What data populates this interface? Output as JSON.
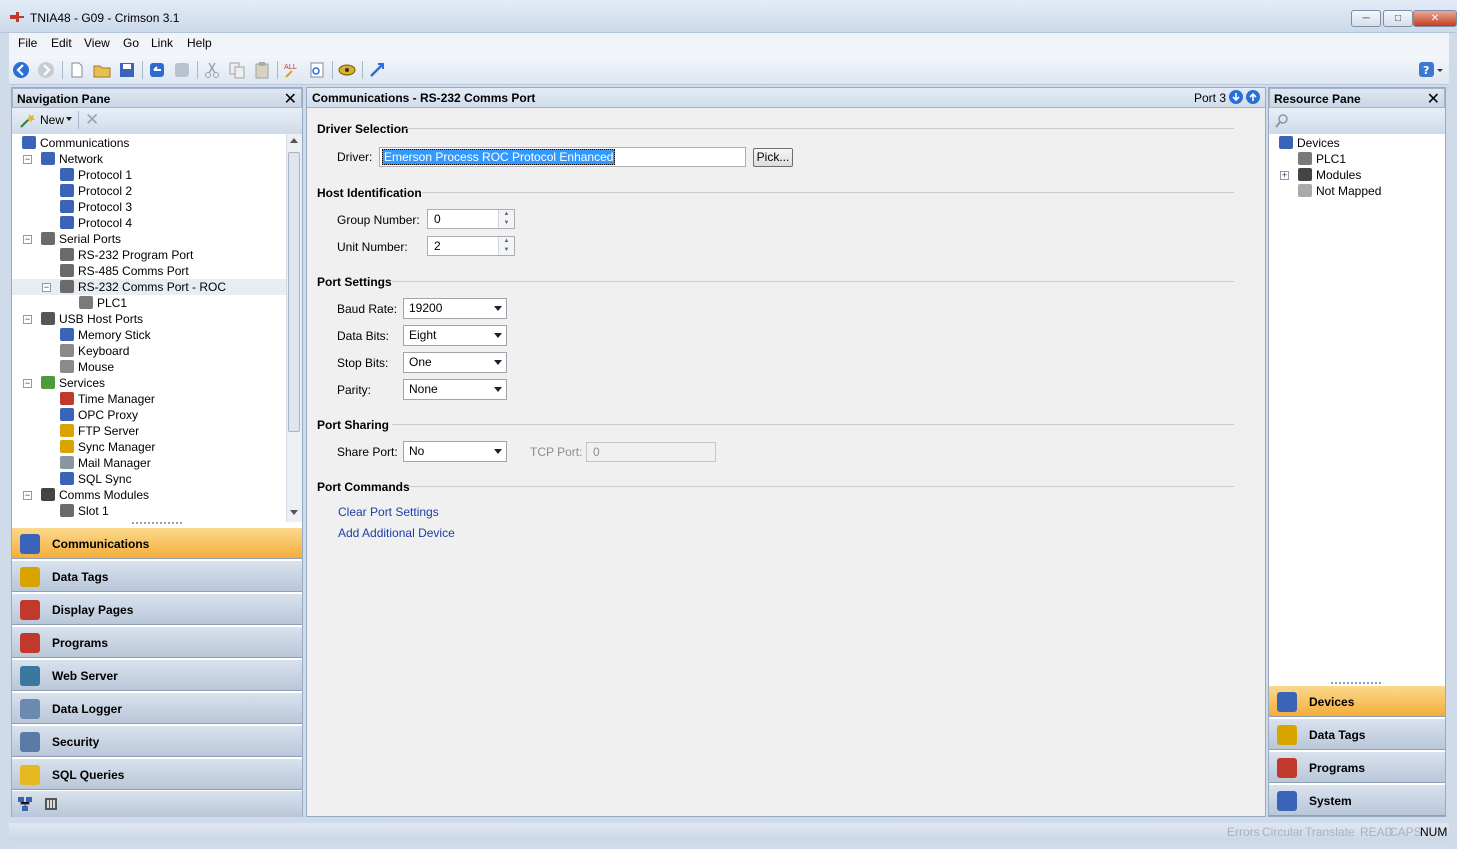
{
  "window": {
    "title": "TNIA48 - G09 - Crimson 3.1"
  },
  "menu": [
    "File",
    "Edit",
    "View",
    "Go",
    "Link",
    "Help"
  ],
  "navigation_pane": {
    "title": "Navigation Pane",
    "new_label": "New",
    "tree": [
      {
        "label": "Communications",
        "level": 0,
        "icon": "communications-icon"
      },
      {
        "label": "Network",
        "level": 1,
        "icon": "network-icon",
        "expander": "minus"
      },
      {
        "label": "Protocol 1",
        "level": 2,
        "icon": "protocol-icon"
      },
      {
        "label": "Protocol 2",
        "level": 2,
        "icon": "protocol-icon"
      },
      {
        "label": "Protocol 3",
        "level": 2,
        "icon": "protocol-icon"
      },
      {
        "label": "Protocol 4",
        "level": 2,
        "icon": "protocol-icon"
      },
      {
        "label": "Serial Ports",
        "level": 1,
        "icon": "serial-port-icon",
        "expander": "minus"
      },
      {
        "label": "RS-232 Program Port",
        "level": 2,
        "icon": "serial-port-icon"
      },
      {
        "label": "RS-485 Comms Port",
        "level": 2,
        "icon": "serial-port-icon"
      },
      {
        "label": "RS-232 Comms Port - ROC",
        "level": 2,
        "icon": "serial-port-icon",
        "expander": "minus",
        "selected": true
      },
      {
        "label": "PLC1",
        "level": 3,
        "icon": "plc-icon"
      },
      {
        "label": "USB Host Ports",
        "level": 1,
        "icon": "usb-icon",
        "expander": "minus"
      },
      {
        "label": "Memory Stick",
        "level": 2,
        "icon": "memory-stick-icon"
      },
      {
        "label": "Keyboard",
        "level": 2,
        "icon": "keyboard-icon"
      },
      {
        "label": "Mouse",
        "level": 2,
        "icon": "mouse-icon"
      },
      {
        "label": "Services",
        "level": 1,
        "icon": "services-icon",
        "expander": "minus"
      },
      {
        "label": "Time Manager",
        "level": 2,
        "icon": "time-manager-icon"
      },
      {
        "label": "OPC Proxy",
        "level": 2,
        "icon": "opc-proxy-icon"
      },
      {
        "label": "FTP Server",
        "level": 2,
        "icon": "ftp-server-icon"
      },
      {
        "label": "Sync Manager",
        "level": 2,
        "icon": "sync-manager-icon"
      },
      {
        "label": "Mail Manager",
        "level": 2,
        "icon": "mail-manager-icon"
      },
      {
        "label": "SQL Sync",
        "level": 2,
        "icon": "sql-sync-icon"
      },
      {
        "label": "Comms Modules",
        "level": 1,
        "icon": "comms-modules-icon",
        "expander": "minus"
      },
      {
        "label": "Slot 1",
        "level": 2,
        "icon": "slot-icon"
      }
    ],
    "buttons": [
      {
        "label": "Communications",
        "icon": "communications-icon",
        "selected": true
      },
      {
        "label": "Data Tags",
        "icon": "data-tags-icon"
      },
      {
        "label": "Display Pages",
        "icon": "display-pages-icon"
      },
      {
        "label": "Programs",
        "icon": "programs-icon"
      },
      {
        "label": "Web Server",
        "icon": "web-server-icon"
      },
      {
        "label": "Data Logger",
        "icon": "data-logger-icon"
      },
      {
        "label": "Security",
        "icon": "security-icon"
      },
      {
        "label": "SQL Queries",
        "icon": "sql-queries-icon"
      }
    ]
  },
  "content": {
    "header_title": "Communications - RS-232 Comms Port",
    "port_label": "Port 3",
    "driver_selection": {
      "section": "Driver Selection",
      "driver_label": "Driver:",
      "driver_value": "Emerson Process ROC Protocol Enhanced",
      "pick_label": "Pick..."
    },
    "host_identification": {
      "section": "Host Identification",
      "group_label": "Group Number:",
      "group_value": "0",
      "unit_label": "Unit Number:",
      "unit_value": "2"
    },
    "port_settings": {
      "section": "Port Settings",
      "baud_label": "Baud Rate:",
      "baud_value": "19200",
      "data_bits_label": "Data Bits:",
      "data_bits_value": "Eight",
      "stop_bits_label": "Stop Bits:",
      "stop_bits_value": "One",
      "parity_label": "Parity:",
      "parity_value": "None"
    },
    "port_sharing": {
      "section": "Port Sharing",
      "share_label": "Share Port:",
      "share_value": "No",
      "tcp_label": "TCP Port:",
      "tcp_value": "0"
    },
    "port_commands": {
      "section": "Port Commands",
      "clear": "Clear Port Settings",
      "add": "Add Additional Device"
    }
  },
  "resource_pane": {
    "title": "Resource Pane",
    "tree": [
      {
        "label": "Devices",
        "level": 0,
        "icon": "devices-icon"
      },
      {
        "label": "PLC1",
        "level": 1,
        "icon": "plc-icon"
      },
      {
        "label": "Modules",
        "level": 1,
        "icon": "modules-icon",
        "expander": "plus"
      },
      {
        "label": "Not Mapped",
        "level": 1,
        "icon": "not-mapped-icon"
      }
    ],
    "buttons": [
      {
        "label": "Devices",
        "icon": "devices-icon",
        "selected": true
      },
      {
        "label": "Data Tags",
        "icon": "data-tags-icon"
      },
      {
        "label": "Programs",
        "icon": "programs-icon"
      },
      {
        "label": "System",
        "icon": "system-icon"
      }
    ]
  },
  "statusbar": [
    "Errors",
    "Circular",
    "Translate",
    "READ",
    "CAPS",
    "NUM"
  ],
  "colors": {
    "accent_selected": "#f4ad3a",
    "link": "#1a3ea8",
    "selection": "#3399ff"
  }
}
